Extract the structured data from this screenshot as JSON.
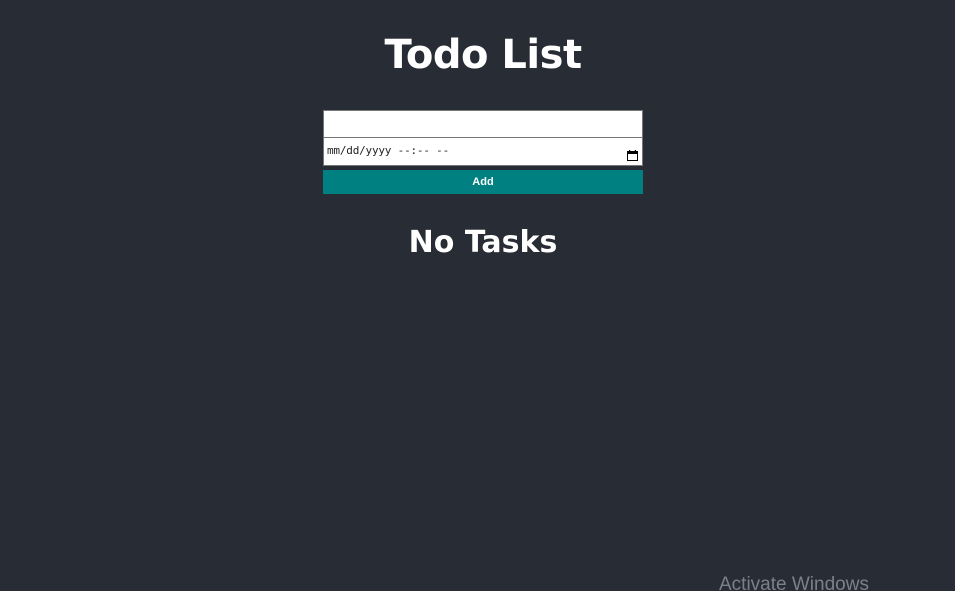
{
  "header": {
    "title": "Todo List"
  },
  "form": {
    "task_input_value": "",
    "task_input_placeholder": "",
    "datetime_placeholder": "mm/dd/yyyy --:-- --",
    "calendar_icon": "calendar-icon",
    "add_label": "Add"
  },
  "tasks": {
    "empty_message": "No Tasks"
  },
  "watermark": {
    "text": "Activate Windows"
  },
  "colors": {
    "background": "#282c34",
    "accent": "#008080",
    "text": "#ffffff"
  }
}
